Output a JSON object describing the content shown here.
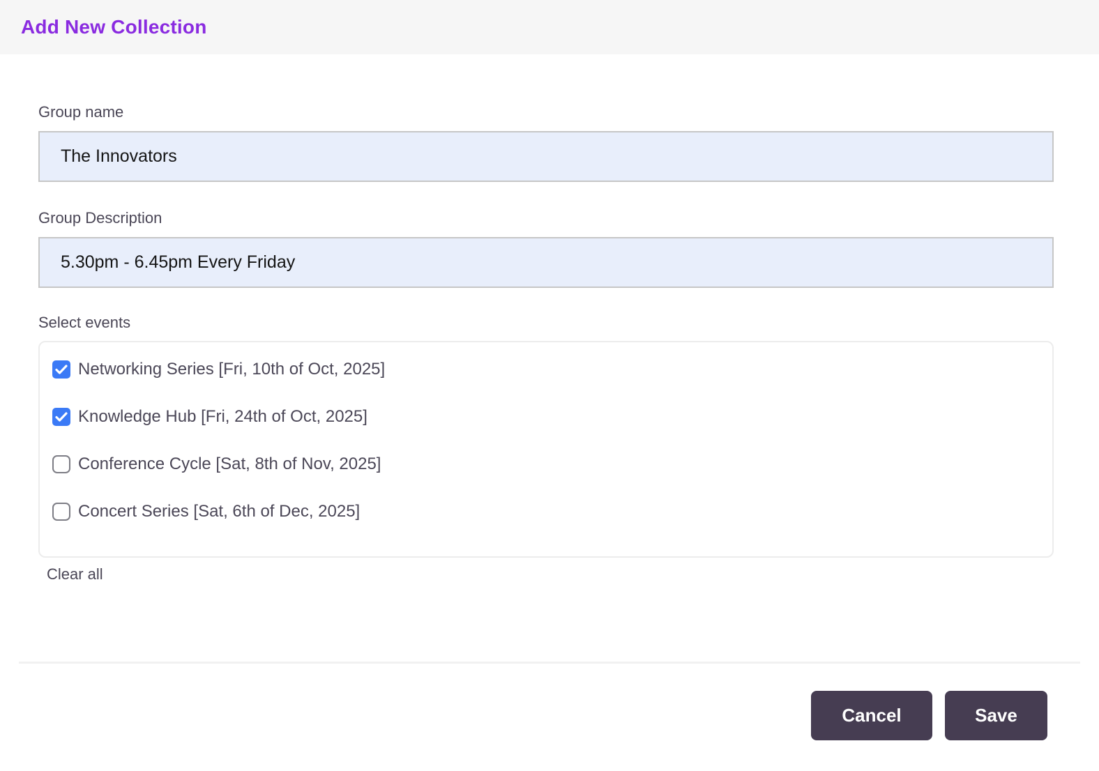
{
  "header": {
    "title": "Add New Collection"
  },
  "form": {
    "group_name": {
      "label": "Group name",
      "value": "The Innovators"
    },
    "group_description": {
      "label": "Group Description",
      "value": "5.30pm - 6.45pm Every Friday"
    },
    "select_events": {
      "label": "Select events",
      "options": [
        {
          "label": "Networking Series [Fri, 10th of Oct, 2025]",
          "checked": true
        },
        {
          "label": "Knowledge Hub [Fri, 24th of Oct, 2025]",
          "checked": true
        },
        {
          "label": "Conference Cycle [Sat, 8th of Nov, 2025]",
          "checked": false
        },
        {
          "label": "Concert Series [Sat, 6th of Dec, 2025]",
          "checked": false
        }
      ],
      "clear_all_label": "Clear all"
    }
  },
  "footer": {
    "cancel_label": "Cancel",
    "save_label": "Save"
  },
  "colors": {
    "accent_purple": "#8a2be0",
    "checkbox_checked_blue": "#3b7af6",
    "button_bg": "#463d52",
    "input_bg": "#e8eefb",
    "header_bg": "#f6f6f6",
    "label_text": "#4a4656"
  }
}
